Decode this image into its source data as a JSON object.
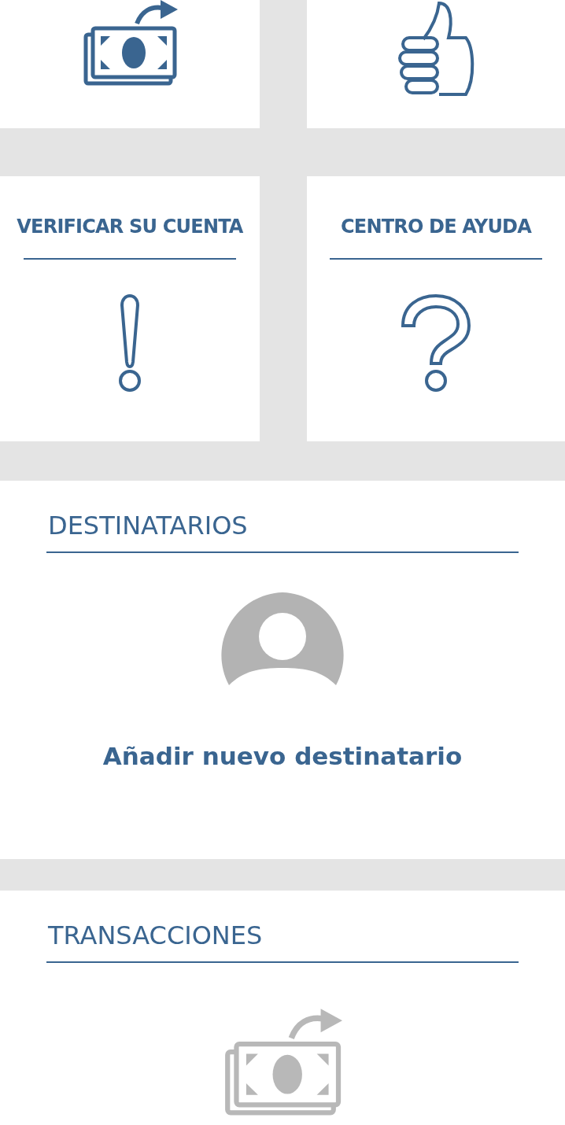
{
  "tiles": [
    {
      "kind": "money"
    },
    {
      "kind": "thumb"
    },
    {
      "kind": "alert",
      "label": "VERIFICAR SU CUENTA"
    },
    {
      "kind": "help",
      "label": "CENTRO DE AYUDA"
    }
  ],
  "recipients": {
    "title": "DESTINATARIOS",
    "add_label": "Añadir nuevo destinatario"
  },
  "transactions": {
    "title": "TRANSACCIONES"
  }
}
